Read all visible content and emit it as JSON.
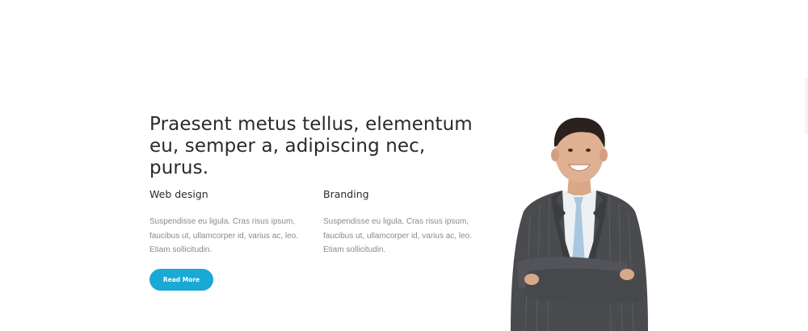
{
  "hero": {
    "headline_line1": "Praesent metus tellus, elementum",
    "headline_line2": "eu, semper a, adipiscing nec, purus."
  },
  "columns": [
    {
      "title": "Web design",
      "body": "Suspendisse eu ligula. Cras risus ipsum, faucibus ut, ullamcorper id, varius ac, leo. Etiam sollicitudin."
    },
    {
      "title": "Branding",
      "body": "Suspendisse eu ligula. Cras risus ipsum, faucibus ut, ullamcorper id, varius ac, leo. Etiam sollicitudin."
    }
  ],
  "cta": {
    "label": "Read More"
  },
  "colors": {
    "accent": "#19a9d5",
    "heading": "#2a2a2a",
    "body_text": "#8a8a8a",
    "suit": "#4a4b4f",
    "tie": "#aac7e0"
  }
}
